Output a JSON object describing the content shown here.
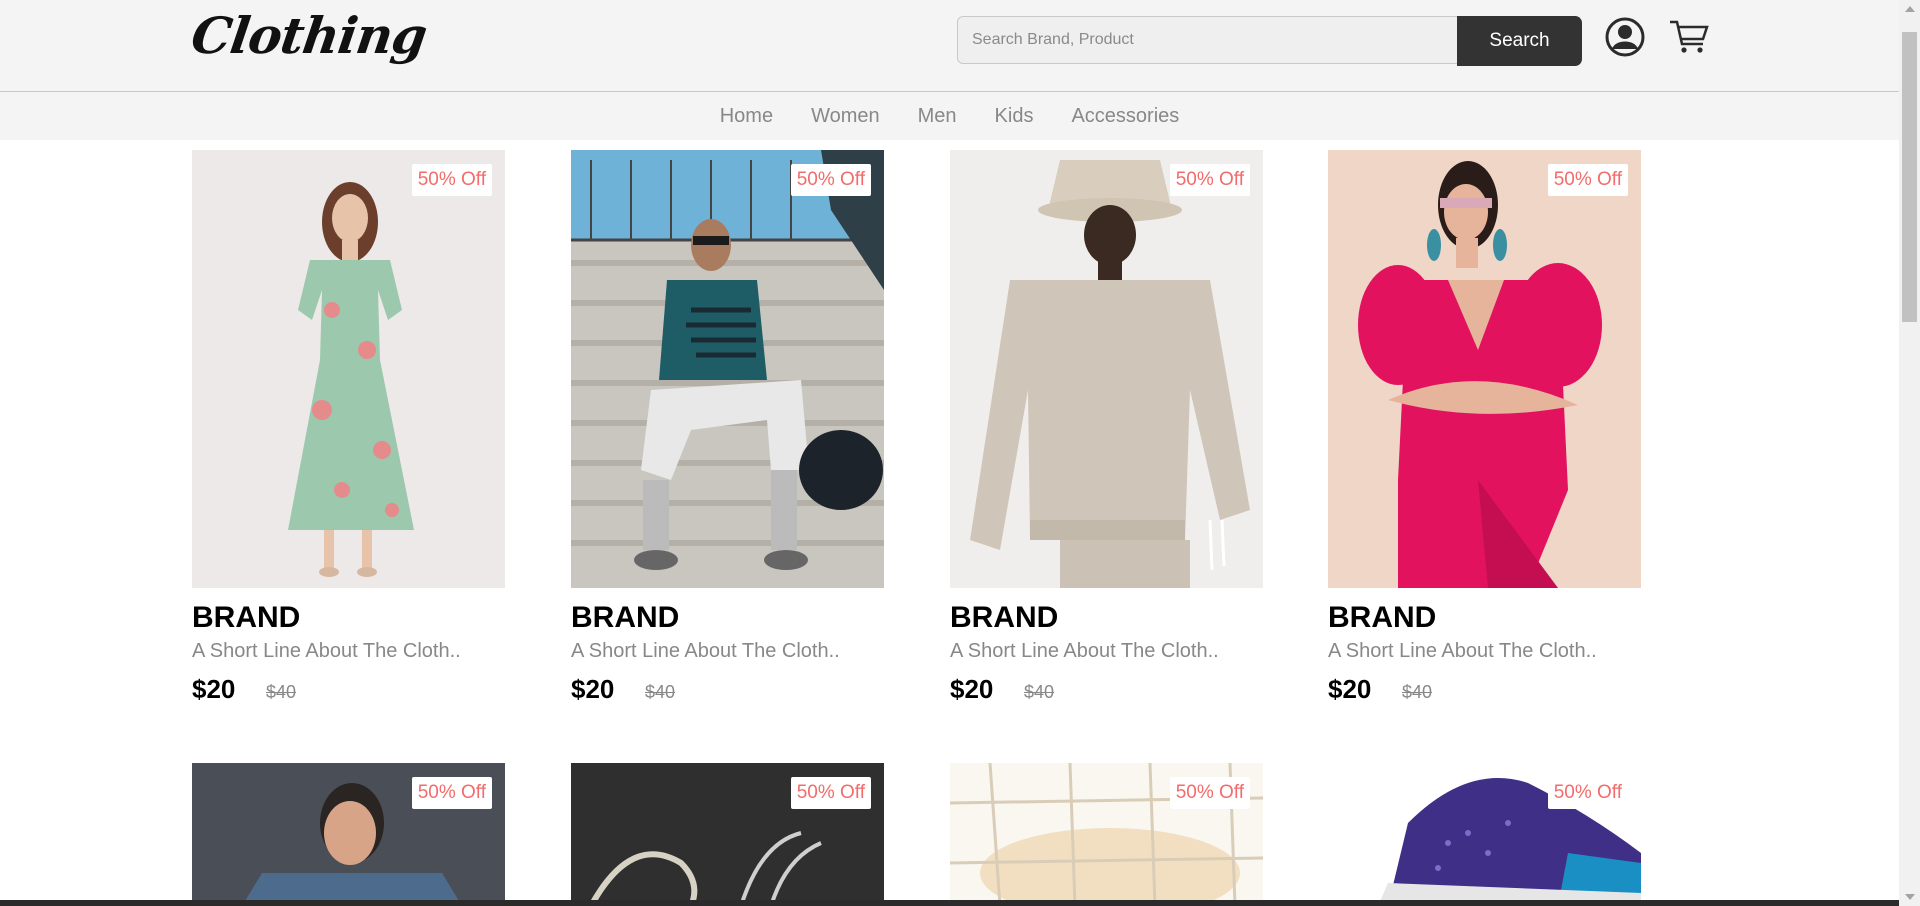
{
  "header": {
    "logo": "Clothing",
    "search_placeholder": "Search Brand, Product",
    "search_button": "Search"
  },
  "nav": [
    "Home",
    "Women",
    "Men",
    "Kids",
    "Accessories"
  ],
  "products": [
    {
      "badge": "50% Off",
      "brand": "BRAND",
      "desc": "A Short Line About The Cloth..",
      "price": "$20",
      "old_price": "$40",
      "image": "woman-green-floral-dress"
    },
    {
      "badge": "50% Off",
      "brand": "BRAND",
      "desc": "A Short Line About The Cloth..",
      "price": "$20",
      "old_price": "$40",
      "image": "man-teal-tshirt-on-stairs"
    },
    {
      "badge": "50% Off",
      "brand": "BRAND",
      "desc": "A Short Line About The Cloth..",
      "price": "$20",
      "old_price": "$40",
      "image": "man-beige-sweatshirt-bucket-hat"
    },
    {
      "badge": "50% Off",
      "brand": "BRAND",
      "desc": "A Short Line About The Cloth..",
      "price": "$20",
      "old_price": "$40",
      "image": "woman-pink-dress"
    },
    {
      "badge": "50% Off",
      "image": "man-blue-shirt"
    },
    {
      "badge": "50% Off",
      "image": "sunglasses-dark-background"
    },
    {
      "badge": "50% Off",
      "image": "blurred-net-light"
    },
    {
      "badge": "50% Off",
      "image": "purple-sneaker"
    }
  ],
  "colors": {
    "badge_text": "#f36b6b",
    "search_button_bg": "#333333",
    "header_bg": "#f4f4f4"
  }
}
